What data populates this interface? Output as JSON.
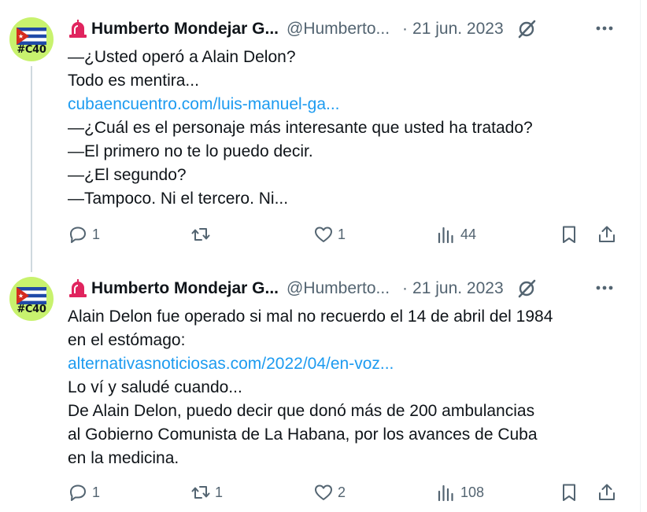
{
  "tweets": [
    {
      "author_name": "Humberto Mondejar G...",
      "handle": "@Humberto...",
      "separator": "·",
      "date": "21 jun. 2023",
      "avatar_tag": "#C40",
      "lines": [
        {
          "text": "—¿Usted operó a Alain Delon?",
          "link": false
        },
        {
          "text": "Todo es mentira...",
          "link": false
        },
        {
          "text": "cubaencuentro.com/luis-manuel-ga...",
          "link": true
        },
        {
          "text": "—¿Cuál es el personaje más interesante que usted ha tratado?",
          "link": false
        },
        {
          "text": "—El primero no te lo puedo decir.",
          "link": false
        },
        {
          "text": "—¿El segundo?",
          "link": false
        },
        {
          "text": "—Tampoco. Ni el tercero. Ni...",
          "link": false
        }
      ],
      "reply_count": "1",
      "retweet_count": "",
      "like_count": "1",
      "views_count": "44"
    },
    {
      "author_name": "Humberto Mondejar G...",
      "handle": "@Humberto...",
      "separator": "·",
      "date": "21 jun. 2023",
      "avatar_tag": "#C40",
      "lines": [
        {
          "text": "Alain Delon fue operado si mal no recuerdo el 14 de abril del 1984",
          "link": false
        },
        {
          "text": "en el estómago:",
          "link": false
        },
        {
          "text": "alternativasnoticiosas.com/2022/04/en-voz...",
          "link": true
        },
        {
          "text": "Lo ví y saludé cuando...",
          "link": false
        },
        {
          "text": "De Alain Delon, puedo decir que donó más de 200 ambulancias",
          "link": false
        },
        {
          "text": "al Gobierno Comunista de La Habana, por los avances de Cuba",
          "link": false
        },
        {
          "text": "en la medicina.",
          "link": false
        }
      ],
      "reply_count": "1",
      "retweet_count": "1",
      "like_count": "2",
      "views_count": "108"
    }
  ],
  "colors": {
    "text": "#0f1419",
    "secondary": "#536471",
    "link": "#1d9bf0",
    "avatar_bg": "#c8f26e",
    "thread_line": "#cfd9de",
    "siren_red": "#e0245e"
  },
  "icons": [
    "siren-icon",
    "cuba-flag-icon",
    "grok-icon",
    "more-icon",
    "reply-icon",
    "retweet-icon",
    "like-icon",
    "views-icon",
    "bookmark-icon",
    "share-icon"
  ]
}
